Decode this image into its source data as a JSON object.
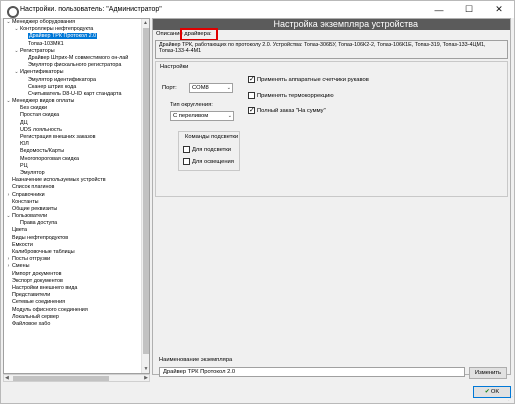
{
  "window": {
    "title": "Настройки. пользователь: \"Администратор\"",
    "minimize": "—",
    "maximize": "☐",
    "close": "✕"
  },
  "tree": [
    {
      "label": "Менеджер оборудования",
      "level": 0,
      "exp": "⌄"
    },
    {
      "label": "Контроллеры нефтепродукта",
      "level": 1,
      "exp": "⌄"
    },
    {
      "label": "Драйвер ТРК Протокол 2.0",
      "level": 2,
      "exp": "",
      "selected": true
    },
    {
      "label": "Топаз-103МК1",
      "level": 2,
      "exp": ""
    },
    {
      "label": "Регистраторы",
      "level": 1,
      "exp": "⌄"
    },
    {
      "label": "Драйвер Штрих-М совместимого он-лай",
      "level": 2,
      "exp": ""
    },
    {
      "label": "Эмулятор фискального регистратора",
      "level": 2,
      "exp": ""
    },
    {
      "label": "Идентификаторы",
      "level": 1,
      "exp": "⌄"
    },
    {
      "label": "Эмулятор идентификатора",
      "level": 2,
      "exp": ""
    },
    {
      "label": "Сканер штрих кода",
      "level": 2,
      "exp": ""
    },
    {
      "label": "Считыватель D8-U-ID карт стандарта",
      "level": 2,
      "exp": ""
    },
    {
      "label": "Менеджер видов оплаты",
      "level": 0,
      "exp": "⌄"
    },
    {
      "label": "Без скидки",
      "level": 1,
      "exp": ""
    },
    {
      "label": "Простая скидка",
      "level": 1,
      "exp": ""
    },
    {
      "label": "ДЦ",
      "level": 1,
      "exp": ""
    },
    {
      "label": "UDS лояльность",
      "level": 1,
      "exp": ""
    },
    {
      "label": "Регистрация внешних заказов",
      "level": 1,
      "exp": ""
    },
    {
      "label": "ЮЛ",
      "level": 1,
      "exp": ""
    },
    {
      "label": "Ведомость/Карты",
      "level": 1,
      "exp": ""
    },
    {
      "label": "Многопороговая скидка",
      "level": 1,
      "exp": ""
    },
    {
      "label": "РЦ",
      "level": 1,
      "exp": ""
    },
    {
      "label": "Эмулятор",
      "level": 1,
      "exp": ""
    },
    {
      "label": "Назначение используемых устройств",
      "level": 0,
      "exp": ""
    },
    {
      "label": "Список плагинов",
      "level": 0,
      "exp": ""
    },
    {
      "label": "Справочники",
      "level": 0,
      "exp": "›"
    },
    {
      "label": "Константы",
      "level": 0,
      "exp": ""
    },
    {
      "label": "Общие реквизиты",
      "level": 0,
      "exp": ""
    },
    {
      "label": "Пользователи",
      "level": 0,
      "exp": "⌄"
    },
    {
      "label": "Права доступа",
      "level": 1,
      "exp": ""
    },
    {
      "label": "Цвета",
      "level": 0,
      "exp": ""
    },
    {
      "label": "Виды нефтепродуктов",
      "level": 0,
      "exp": ""
    },
    {
      "label": "Емкости",
      "level": 0,
      "exp": ""
    },
    {
      "label": "Калибровочные таблицы",
      "level": 0,
      "exp": ""
    },
    {
      "label": "Посты отгрузки",
      "level": 0,
      "exp": "›"
    },
    {
      "label": "Смены",
      "level": 0,
      "exp": "›"
    },
    {
      "label": "Импорт документов",
      "level": 0,
      "exp": ""
    },
    {
      "label": "Экспорт документов",
      "level": 0,
      "exp": ""
    },
    {
      "label": "Настройки внешнего вида",
      "level": 0,
      "exp": ""
    },
    {
      "label": "Представители",
      "level": 0,
      "exp": ""
    },
    {
      "label": "Сетевые соединения",
      "level": 0,
      "exp": ""
    },
    {
      "label": "Модуль офисного соединения",
      "level": 0,
      "exp": ""
    },
    {
      "label": "Локальный сервер",
      "level": 0,
      "exp": ""
    },
    {
      "label": "Файловое хабо",
      "level": 0,
      "exp": ""
    }
  ],
  "panel": {
    "header": "Настройка экземпляра устройства",
    "desc_label": "Описание драйвера:",
    "description": "Драйвер ТРК, работающих по протоколу 2.0. Устройства: Топаз-306БУ, Топаз-106К2-2, Топаз-106К1Е, Топаз-319, Топаз-133-4ЦМ1, Топаз-133-4-4М1",
    "settings_title": "Настройки",
    "port_label": "Порт:",
    "port_value": "COM8",
    "rounding_label": "Тип округления:",
    "rounding_value": "С переливом",
    "commands_title": "Команды подсветки",
    "chk_backlight": "Для подсветки",
    "chk_lighting": "Для освещения",
    "chk_hw_counters": "Применять аппаратные счетчики рукавов",
    "chk_thermo": "Применять термокоррекцию",
    "chk_full_order": "Полный заказ \"На сумму\"",
    "instance_label": "Наименование экземпляра",
    "instance_value": "Драйвер ТРК Протокол 2.0",
    "rename_button": "Изменить",
    "ok_button": "OK"
  },
  "states": {
    "chk_hw_counters": true,
    "chk_thermo": false,
    "chk_full_order": true,
    "chk_backlight": false,
    "chk_lighting": false
  }
}
